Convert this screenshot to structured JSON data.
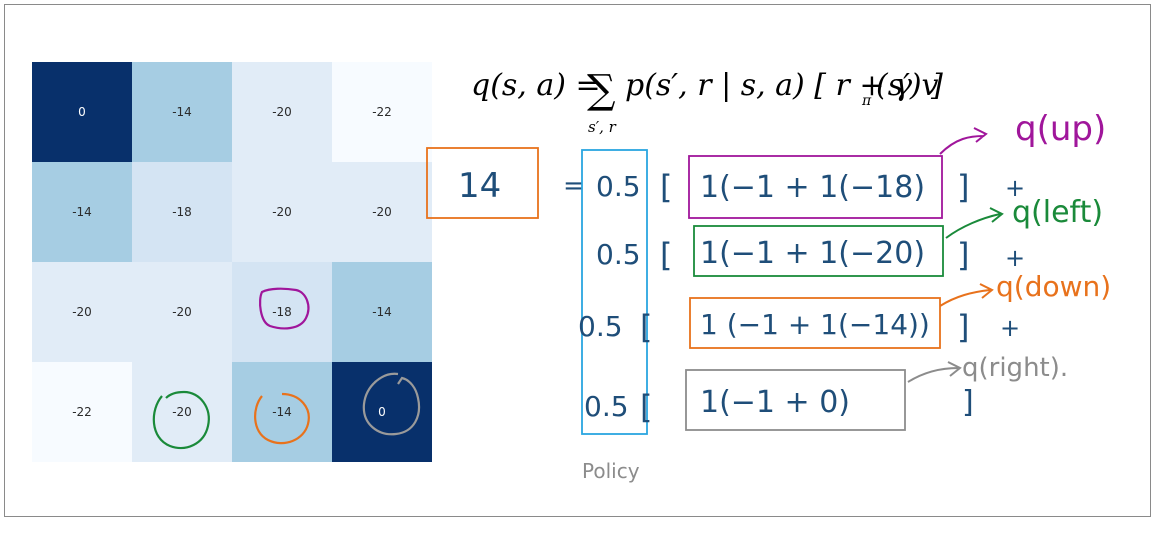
{
  "grid": {
    "values": [
      [
        "0",
        "-14",
        "-20",
        "-22"
      ],
      [
        "-14",
        "-18",
        "-20",
        "-20"
      ],
      [
        "-20",
        "-20",
        "-18",
        "-14"
      ],
      [
        "-22",
        "-20",
        "-14",
        "0"
      ]
    ],
    "colors": [
      [
        "#08306b",
        "#a6cde3",
        "#e1ecf7",
        "#f7fbff"
      ],
      [
        "#a6cde3",
        "#d4e4f3",
        "#e1ecf7",
        "#e1ecf7"
      ],
      [
        "#e1ecf7",
        "#e1ecf7",
        "#d4e4f3",
        "#a6cde3"
      ],
      [
        "#f7fbff",
        "#e1ecf7",
        "#a6cde3",
        "#08306b"
      ]
    ]
  },
  "equation": {
    "lhs": "q(s, a) = ",
    "sum_symbol": "∑",
    "sum_sub": "s′, r",
    "rhs": "p(s′, r | s, a) [ r + γ v",
    "pi_sub": "π",
    "tail": "(s′) ]"
  },
  "worked": {
    "result": "14",
    "equals": "=",
    "policy_label": "Policy",
    "rows": [
      {
        "prob": "0.5",
        "open": "[",
        "expr": "1(−1 + 1(−18)",
        "close": "]",
        "plus": "+",
        "action": "q(up)"
      },
      {
        "prob": "0.5",
        "open": "[",
        "expr": "1(−1 + 1(−20)",
        "close": "]",
        "plus": "+",
        "action": "q(left)"
      },
      {
        "prob": "0.5",
        "open": "[",
        "expr": "1  (−1 + 1(−14))",
        "close": "]",
        "plus": "+",
        "action": "q(down)"
      },
      {
        "prob": "0.5",
        "open": "[",
        "expr": "1(−1 + 0)",
        "close": "]",
        "plus": "",
        "action": "q(right)."
      }
    ]
  },
  "colors": {
    "ink": "#1f4e79",
    "up": "#a0169b",
    "left": "#1a8a3a",
    "down": "#e8721c",
    "right": "#8c8c8c",
    "policy": "#2aa6e0",
    "result": "#e8721c"
  }
}
